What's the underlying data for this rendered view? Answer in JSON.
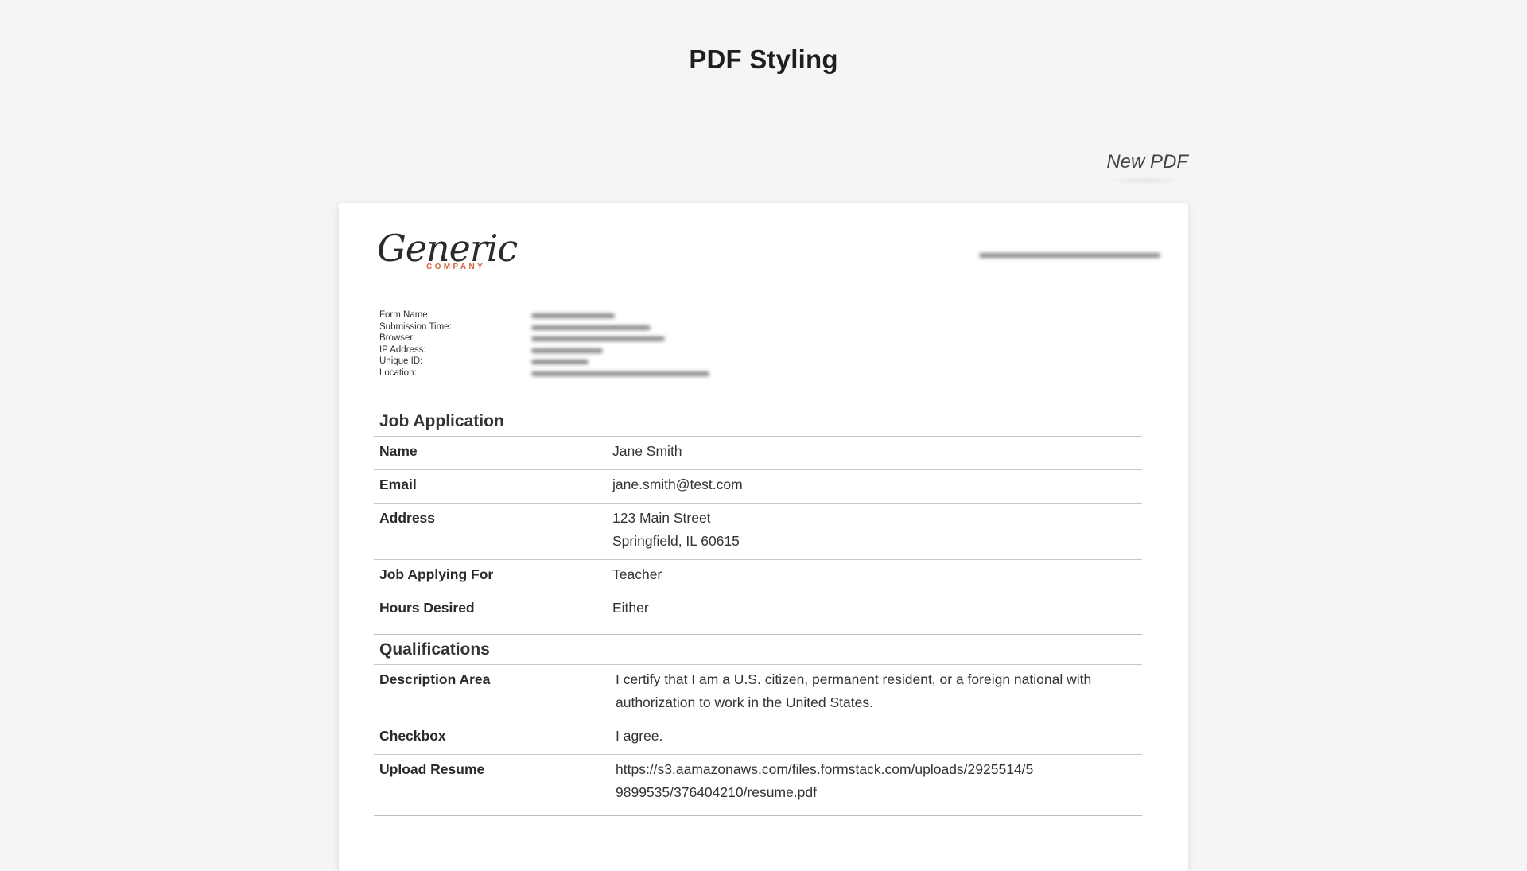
{
  "page": {
    "title": "PDF Styling"
  },
  "actions": {
    "new_pdf": "New PDF"
  },
  "logo": {
    "script": "Generic",
    "sub": "COMPANY"
  },
  "meta": {
    "labels": [
      "Form Name:",
      "Submission Time:",
      "Browser:",
      "IP Address:",
      "Unique ID:",
      "Location:"
    ]
  },
  "sections": {
    "job": {
      "title": "Job Application",
      "rows": [
        {
          "label": "Name",
          "value": [
            "Jane Smith"
          ]
        },
        {
          "label": "Email",
          "value": [
            "jane.smith@test.com"
          ]
        },
        {
          "label": "Address",
          "value": [
            "123 Main Street",
            "Springfield, IL 60615"
          ]
        },
        {
          "label": "Job Applying For",
          "value": [
            "Teacher"
          ]
        },
        {
          "label": "Hours Desired",
          "value": [
            "Either"
          ]
        }
      ]
    },
    "qual": {
      "title": "Qualifications",
      "rows": [
        {
          "label": "Description Area",
          "value": [
            "I certify that I am a U.S. citizen, permanent resident, or a foreign national with",
            "authorization to work in the United States."
          ]
        },
        {
          "label": "Checkbox",
          "value": [
            "I agree."
          ]
        },
        {
          "label": "Upload Resume",
          "value": [
            "https://s3.aamazonaws.com/files.formstack.com/uploads/2925514/5",
            "9899535/376404210/resume.pdf"
          ]
        }
      ]
    }
  }
}
